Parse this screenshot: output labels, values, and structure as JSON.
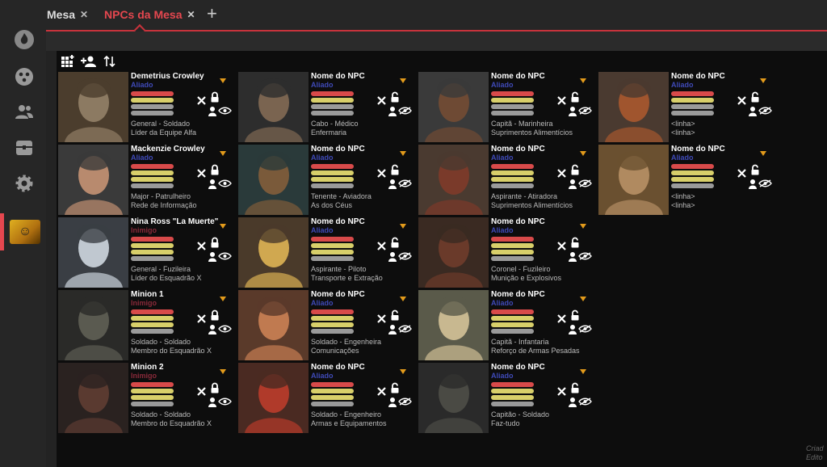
{
  "tabs": [
    {
      "label": "Mesa",
      "close": "✕",
      "active": false
    },
    {
      "label": "NPCs da Mesa",
      "close": "✕",
      "active": true
    }
  ],
  "add_tab": "+",
  "colors": {
    "accent": "#c8333c",
    "ally": "#3f4ab8",
    "enemy": "#8a2a3a"
  },
  "credit": {
    "line1": "Criad",
    "line2": "Edito"
  },
  "npcs": [
    {
      "name": "Demetrius Crowley",
      "role": "Aliado",
      "line1": "General - Soldado",
      "line2": "Líder da Equipe Alfa",
      "bar_colors": [
        "red",
        "yellow",
        "gray",
        "gray"
      ],
      "lock": "locked",
      "eye": "visible",
      "portrait_colors": [
        "#8c7a62",
        "#4b3d2d"
      ]
    },
    {
      "name": "Nome do NPC",
      "role": "Aliado",
      "line1": "Cabo - Médico",
      "line2": "Enfermaria",
      "bar_colors": [
        "red",
        "yellow",
        "gray",
        "gray"
      ],
      "lock": "unlocked",
      "eye": "hidden",
      "portrait_colors": [
        "#7a6450",
        "#2d2d2d"
      ]
    },
    {
      "name": "Nome do NPC",
      "role": "Aliado",
      "line1": "Capitã - Marinheira",
      "line2": "Suprimentos Alimentícios",
      "bar_colors": [
        "red",
        "yellow",
        "gray",
        "gray"
      ],
      "lock": "unlocked",
      "eye": "hidden",
      "portrait_colors": [
        "#6e4a34",
        "#3a3a3a"
      ]
    },
    {
      "name": "Nome do NPC",
      "role": "Aliado",
      "line1": "<linha>",
      "line2": "<linha>",
      "bar_colors": [
        "red",
        "yellow",
        "gray",
        "gray"
      ],
      "lock": "unlocked",
      "eye": "hidden",
      "portrait_colors": [
        "#a0552e",
        "#4a3a30"
      ]
    },
    {
      "name": "Mackenzie Crowley",
      "role": "Aliado",
      "line1": "Major - Patrulheiro",
      "line2": "Rede de Informação",
      "bar_colors": [
        "red",
        "yellow",
        "yellow",
        "gray"
      ],
      "lock": "locked",
      "eye": "visible",
      "portrait_colors": [
        "#b88a6e",
        "#3a3a3a"
      ]
    },
    {
      "name": "Nome do NPC",
      "role": "Aliado",
      "line1": "Tenente - Aviadora",
      "line2": "As dos Céus",
      "bar_colors": [
        "red",
        "yellow",
        "yellow",
        "gray"
      ],
      "lock": "unlocked",
      "eye": "hidden",
      "portrait_colors": [
        "#7a5a3a",
        "#2a3a3a"
      ]
    },
    {
      "name": "Nome do NPC",
      "role": "Aliado",
      "line1": "Aspirante - Atiradora",
      "line2": "Suprimentos Alimentícios",
      "bar_colors": [
        "red",
        "yellow",
        "yellow",
        "gray"
      ],
      "lock": "unlocked",
      "eye": "hidden",
      "portrait_colors": [
        "#7a3a2a",
        "#4a3a30"
      ]
    },
    {
      "name": "Nome do NPC",
      "role": "Aliado",
      "line1": "<linha>",
      "line2": "<linha>",
      "bar_colors": [
        "red",
        "yellow",
        "yellow",
        "gray"
      ],
      "lock": "unlocked",
      "eye": "hidden",
      "portrait_colors": [
        "#b08a60",
        "#6a5030"
      ]
    },
    {
      "name": "Nina Ross \"La Muerte\"",
      "role": "Inimigo",
      "line1": "General - Fuzileira",
      "line2": "Líder do Esquadrão X",
      "bar_colors": [
        "red",
        "yellow",
        "yellow",
        "gray"
      ],
      "lock": "locked",
      "eye": "visible",
      "portrait_colors": [
        "#c0c8d0",
        "#3a3e44"
      ]
    },
    {
      "name": "Nome do NPC",
      "role": "Aliado",
      "line1": "Aspirante - Piloto",
      "line2": "Transporte e Extração",
      "bar_colors": [
        "red",
        "yellow",
        "yellow",
        "gray"
      ],
      "lock": "unlocked",
      "eye": "hidden",
      "portrait_colors": [
        "#d0a850",
        "#4a3a2a"
      ]
    },
    {
      "name": "Nome do NPC",
      "role": "Aliado",
      "line1": "Coronel - Fuzileiro",
      "line2": "Munição e Explosivos",
      "bar_colors": [
        "red",
        "yellow",
        "yellow",
        "gray"
      ],
      "lock": "unlocked",
      "eye": "hidden",
      "portrait_colors": [
        "#6a3a2a",
        "#3a2a22"
      ]
    },
    {
      "name": "Minion 1",
      "role": "Inimigo",
      "line1": "Soldado - Soldado",
      "line2": "Membro do Esquadrão X",
      "bar_colors": [
        "red",
        "yellow",
        "yellow",
        "gray"
      ],
      "lock": "locked",
      "eye": "visible",
      "portrait_colors": [
        "#5a5a50",
        "#2a2a28"
      ]
    },
    {
      "name": "Nome do NPC",
      "role": "Aliado",
      "line1": "Soldado - Engenheira",
      "line2": "Comunicações",
      "bar_colors": [
        "red",
        "yellow",
        "yellow",
        "gray"
      ],
      "lock": "unlocked",
      "eye": "hidden",
      "portrait_colors": [
        "#c07a50",
        "#5a3a2a"
      ]
    },
    {
      "name": "Nome do NPC",
      "role": "Aliado",
      "line1": "Capitã - Infantaria",
      "line2": "Reforço de Armas Pesadas",
      "bar_colors": [
        "red",
        "yellow",
        "yellow",
        "gray"
      ],
      "lock": "unlocked",
      "eye": "hidden",
      "portrait_colors": [
        "#c8b890",
        "#5a5a4a"
      ]
    },
    {
      "name": "Minion 2",
      "role": "Inimigo",
      "line1": "Soldado - Soldado",
      "line2": "Membro do Esquadrão X",
      "bar_colors": [
        "red",
        "yellow",
        "yellow",
        "gray"
      ],
      "lock": "locked",
      "eye": "visible",
      "portrait_colors": [
        "#5a3a30",
        "#2a2220"
      ]
    },
    {
      "name": "Nome do NPC",
      "role": "Aliado",
      "line1": "Soldado - Engenheiro",
      "line2": "Armas e Equipamentos",
      "bar_colors": [
        "red",
        "yellow",
        "yellow",
        "gray"
      ],
      "lock": "unlocked",
      "eye": "hidden",
      "portrait_colors": [
        "#b03a2a",
        "#4a2a22"
      ]
    },
    {
      "name": "Nome do NPC",
      "role": "Aliado",
      "line1": "Capitão - Soldado",
      "line2": "Faz-tudo",
      "bar_colors": [
        "red",
        "yellow",
        "yellow",
        "gray"
      ],
      "lock": "unlocked",
      "eye": "hidden",
      "portrait_colors": [
        "#4a4a44",
        "#2a2a2a"
      ]
    }
  ]
}
